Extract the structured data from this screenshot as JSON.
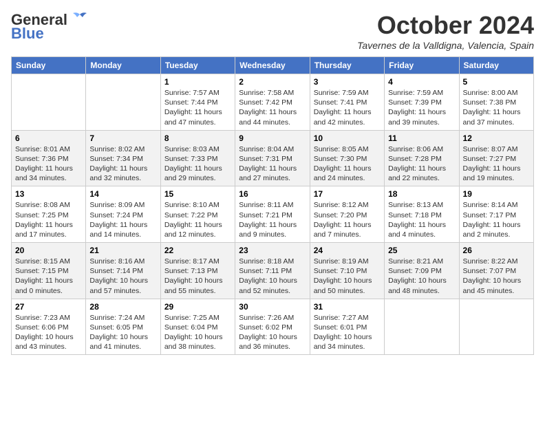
{
  "header": {
    "logo_line1": "General",
    "logo_line2": "Blue",
    "month": "October 2024",
    "location": "Tavernes de la Valldigna, Valencia, Spain"
  },
  "days_of_week": [
    "Sunday",
    "Monday",
    "Tuesday",
    "Wednesday",
    "Thursday",
    "Friday",
    "Saturday"
  ],
  "weeks": [
    [
      {
        "num": "",
        "sunrise": "",
        "sunset": "",
        "daylight": ""
      },
      {
        "num": "",
        "sunrise": "",
        "sunset": "",
        "daylight": ""
      },
      {
        "num": "1",
        "sunrise": "Sunrise: 7:57 AM",
        "sunset": "Sunset: 7:44 PM",
        "daylight": "Daylight: 11 hours and 47 minutes."
      },
      {
        "num": "2",
        "sunrise": "Sunrise: 7:58 AM",
        "sunset": "Sunset: 7:42 PM",
        "daylight": "Daylight: 11 hours and 44 minutes."
      },
      {
        "num": "3",
        "sunrise": "Sunrise: 7:59 AM",
        "sunset": "Sunset: 7:41 PM",
        "daylight": "Daylight: 11 hours and 42 minutes."
      },
      {
        "num": "4",
        "sunrise": "Sunrise: 7:59 AM",
        "sunset": "Sunset: 7:39 PM",
        "daylight": "Daylight: 11 hours and 39 minutes."
      },
      {
        "num": "5",
        "sunrise": "Sunrise: 8:00 AM",
        "sunset": "Sunset: 7:38 PM",
        "daylight": "Daylight: 11 hours and 37 minutes."
      }
    ],
    [
      {
        "num": "6",
        "sunrise": "Sunrise: 8:01 AM",
        "sunset": "Sunset: 7:36 PM",
        "daylight": "Daylight: 11 hours and 34 minutes."
      },
      {
        "num": "7",
        "sunrise": "Sunrise: 8:02 AM",
        "sunset": "Sunset: 7:34 PM",
        "daylight": "Daylight: 11 hours and 32 minutes."
      },
      {
        "num": "8",
        "sunrise": "Sunrise: 8:03 AM",
        "sunset": "Sunset: 7:33 PM",
        "daylight": "Daylight: 11 hours and 29 minutes."
      },
      {
        "num": "9",
        "sunrise": "Sunrise: 8:04 AM",
        "sunset": "Sunset: 7:31 PM",
        "daylight": "Daylight: 11 hours and 27 minutes."
      },
      {
        "num": "10",
        "sunrise": "Sunrise: 8:05 AM",
        "sunset": "Sunset: 7:30 PM",
        "daylight": "Daylight: 11 hours and 24 minutes."
      },
      {
        "num": "11",
        "sunrise": "Sunrise: 8:06 AM",
        "sunset": "Sunset: 7:28 PM",
        "daylight": "Daylight: 11 hours and 22 minutes."
      },
      {
        "num": "12",
        "sunrise": "Sunrise: 8:07 AM",
        "sunset": "Sunset: 7:27 PM",
        "daylight": "Daylight: 11 hours and 19 minutes."
      }
    ],
    [
      {
        "num": "13",
        "sunrise": "Sunrise: 8:08 AM",
        "sunset": "Sunset: 7:25 PM",
        "daylight": "Daylight: 11 hours and 17 minutes."
      },
      {
        "num": "14",
        "sunrise": "Sunrise: 8:09 AM",
        "sunset": "Sunset: 7:24 PM",
        "daylight": "Daylight: 11 hours and 14 minutes."
      },
      {
        "num": "15",
        "sunrise": "Sunrise: 8:10 AM",
        "sunset": "Sunset: 7:22 PM",
        "daylight": "Daylight: 11 hours and 12 minutes."
      },
      {
        "num": "16",
        "sunrise": "Sunrise: 8:11 AM",
        "sunset": "Sunset: 7:21 PM",
        "daylight": "Daylight: 11 hours and 9 minutes."
      },
      {
        "num": "17",
        "sunrise": "Sunrise: 8:12 AM",
        "sunset": "Sunset: 7:20 PM",
        "daylight": "Daylight: 11 hours and 7 minutes."
      },
      {
        "num": "18",
        "sunrise": "Sunrise: 8:13 AM",
        "sunset": "Sunset: 7:18 PM",
        "daylight": "Daylight: 11 hours and 4 minutes."
      },
      {
        "num": "19",
        "sunrise": "Sunrise: 8:14 AM",
        "sunset": "Sunset: 7:17 PM",
        "daylight": "Daylight: 11 hours and 2 minutes."
      }
    ],
    [
      {
        "num": "20",
        "sunrise": "Sunrise: 8:15 AM",
        "sunset": "Sunset: 7:15 PM",
        "daylight": "Daylight: 11 hours and 0 minutes."
      },
      {
        "num": "21",
        "sunrise": "Sunrise: 8:16 AM",
        "sunset": "Sunset: 7:14 PM",
        "daylight": "Daylight: 10 hours and 57 minutes."
      },
      {
        "num": "22",
        "sunrise": "Sunrise: 8:17 AM",
        "sunset": "Sunset: 7:13 PM",
        "daylight": "Daylight: 10 hours and 55 minutes."
      },
      {
        "num": "23",
        "sunrise": "Sunrise: 8:18 AM",
        "sunset": "Sunset: 7:11 PM",
        "daylight": "Daylight: 10 hours and 52 minutes."
      },
      {
        "num": "24",
        "sunrise": "Sunrise: 8:19 AM",
        "sunset": "Sunset: 7:10 PM",
        "daylight": "Daylight: 10 hours and 50 minutes."
      },
      {
        "num": "25",
        "sunrise": "Sunrise: 8:21 AM",
        "sunset": "Sunset: 7:09 PM",
        "daylight": "Daylight: 10 hours and 48 minutes."
      },
      {
        "num": "26",
        "sunrise": "Sunrise: 8:22 AM",
        "sunset": "Sunset: 7:07 PM",
        "daylight": "Daylight: 10 hours and 45 minutes."
      }
    ],
    [
      {
        "num": "27",
        "sunrise": "Sunrise: 7:23 AM",
        "sunset": "Sunset: 6:06 PM",
        "daylight": "Daylight: 10 hours and 43 minutes."
      },
      {
        "num": "28",
        "sunrise": "Sunrise: 7:24 AM",
        "sunset": "Sunset: 6:05 PM",
        "daylight": "Daylight: 10 hours and 41 minutes."
      },
      {
        "num": "29",
        "sunrise": "Sunrise: 7:25 AM",
        "sunset": "Sunset: 6:04 PM",
        "daylight": "Daylight: 10 hours and 38 minutes."
      },
      {
        "num": "30",
        "sunrise": "Sunrise: 7:26 AM",
        "sunset": "Sunset: 6:02 PM",
        "daylight": "Daylight: 10 hours and 36 minutes."
      },
      {
        "num": "31",
        "sunrise": "Sunrise: 7:27 AM",
        "sunset": "Sunset: 6:01 PM",
        "daylight": "Daylight: 10 hours and 34 minutes."
      },
      {
        "num": "",
        "sunrise": "",
        "sunset": "",
        "daylight": ""
      },
      {
        "num": "",
        "sunrise": "",
        "sunset": "",
        "daylight": ""
      }
    ]
  ]
}
